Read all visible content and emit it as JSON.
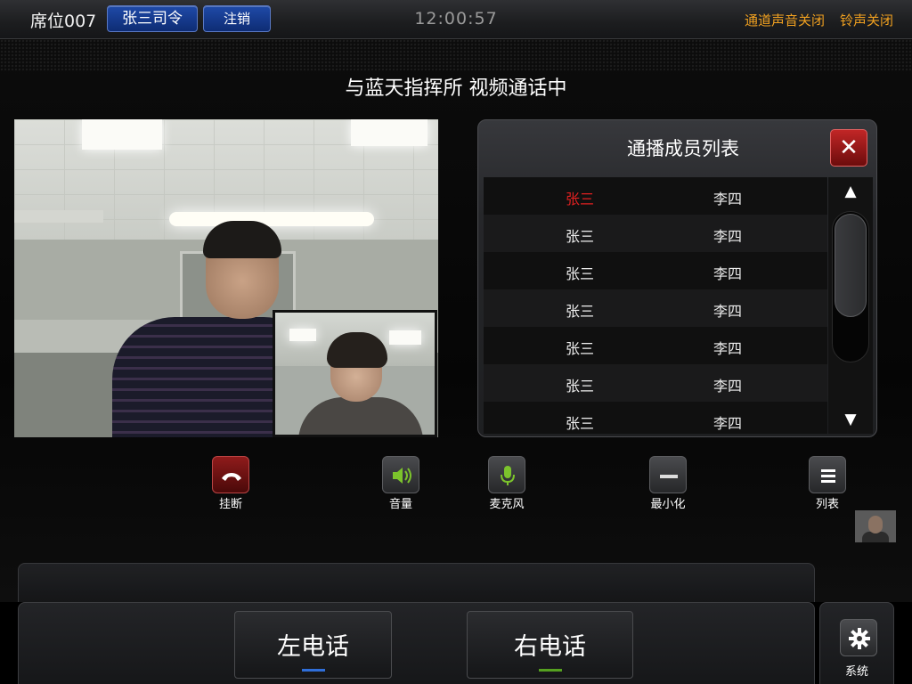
{
  "topbar": {
    "seat": "席位007",
    "user_button": "张三司令",
    "logout_button": "注销",
    "clock": "12:00:57",
    "channel_audio_status": "通道声音关闭",
    "ringtone_status": "铃声关闭"
  },
  "call": {
    "title": "与蓝天指挥所 视频通话中"
  },
  "member_panel": {
    "title": "通播成员列表",
    "close_icon": "close-icon",
    "rows": [
      {
        "left": "张三",
        "right": "李四",
        "active": true
      },
      {
        "left": "张三",
        "right": "李四"
      },
      {
        "left": "张三",
        "right": "李四"
      },
      {
        "left": "张三",
        "right": "李四"
      },
      {
        "left": "张三",
        "right": "李四"
      },
      {
        "left": "张三",
        "right": "李四"
      },
      {
        "left": "张三",
        "right": "李四"
      }
    ]
  },
  "controls": {
    "hangup": "挂断",
    "volume": "音量",
    "microphone": "麦克风",
    "minimize": "最小化",
    "list": "列表"
  },
  "bottom": {
    "left_phone": "左电话",
    "right_phone": "右电话",
    "system": "系统"
  },
  "colors": {
    "accent_blue": "#2f6ed8",
    "accent_green": "#55a020",
    "status_orange": "#f0a020",
    "active_red": "#e02020"
  }
}
